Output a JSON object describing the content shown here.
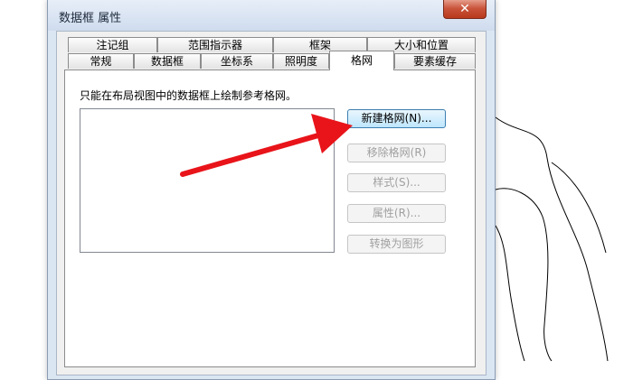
{
  "window": {
    "title": "数据框 属性",
    "close_label": "✕"
  },
  "tabs_row_back": [
    "注记组",
    "范围指示器",
    "框架",
    "大小和位置"
  ],
  "tabs_row_front": [
    "常规",
    "数据框",
    "坐标系",
    "照明度",
    "格网",
    "要素缓存"
  ],
  "active_tab": "格网",
  "grid_page": {
    "description": "只能在布局视图中的数据框上绘制参考格网。",
    "buttons": {
      "new_grid": "新建格网(N)...",
      "remove_grid": "移除格网(R)",
      "style": "样式(S)...",
      "properties": "属性(R)...",
      "convert": "转换为图形"
    },
    "grid_list": []
  },
  "colors": {
    "annotation_arrow": "#e8141a",
    "window_frame": "#dbe6f3"
  }
}
